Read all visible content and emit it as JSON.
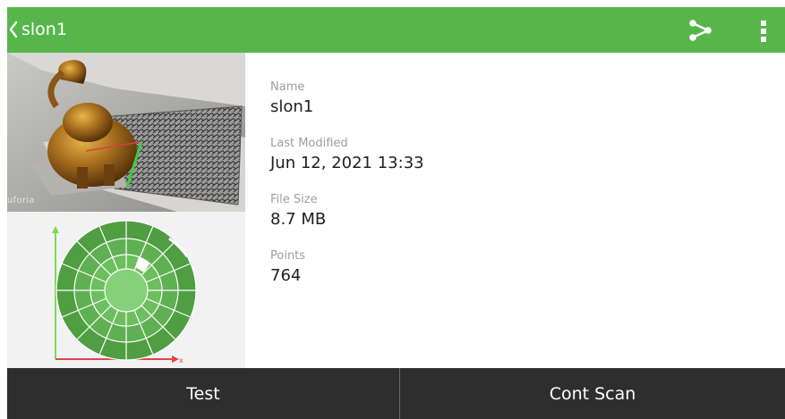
{
  "app_bar": {
    "title": "slon1",
    "back_icon": "chevron-left-icon",
    "share_icon": "share-icon",
    "overflow_icon": "more-vert-icon",
    "color": "#56b64a"
  },
  "preview": {
    "watermark": "uforia"
  },
  "details": [
    {
      "label": "Name",
      "value": "slon1"
    },
    {
      "label": "Last Modified",
      "value": "Jun 12, 2021 13:33"
    },
    {
      "label": "File Size",
      "value": "8.7 MB"
    },
    {
      "label": "Points",
      "value": "764"
    }
  ],
  "actions": {
    "test_label": "Test",
    "cont_scan_label": "Cont Scan"
  }
}
